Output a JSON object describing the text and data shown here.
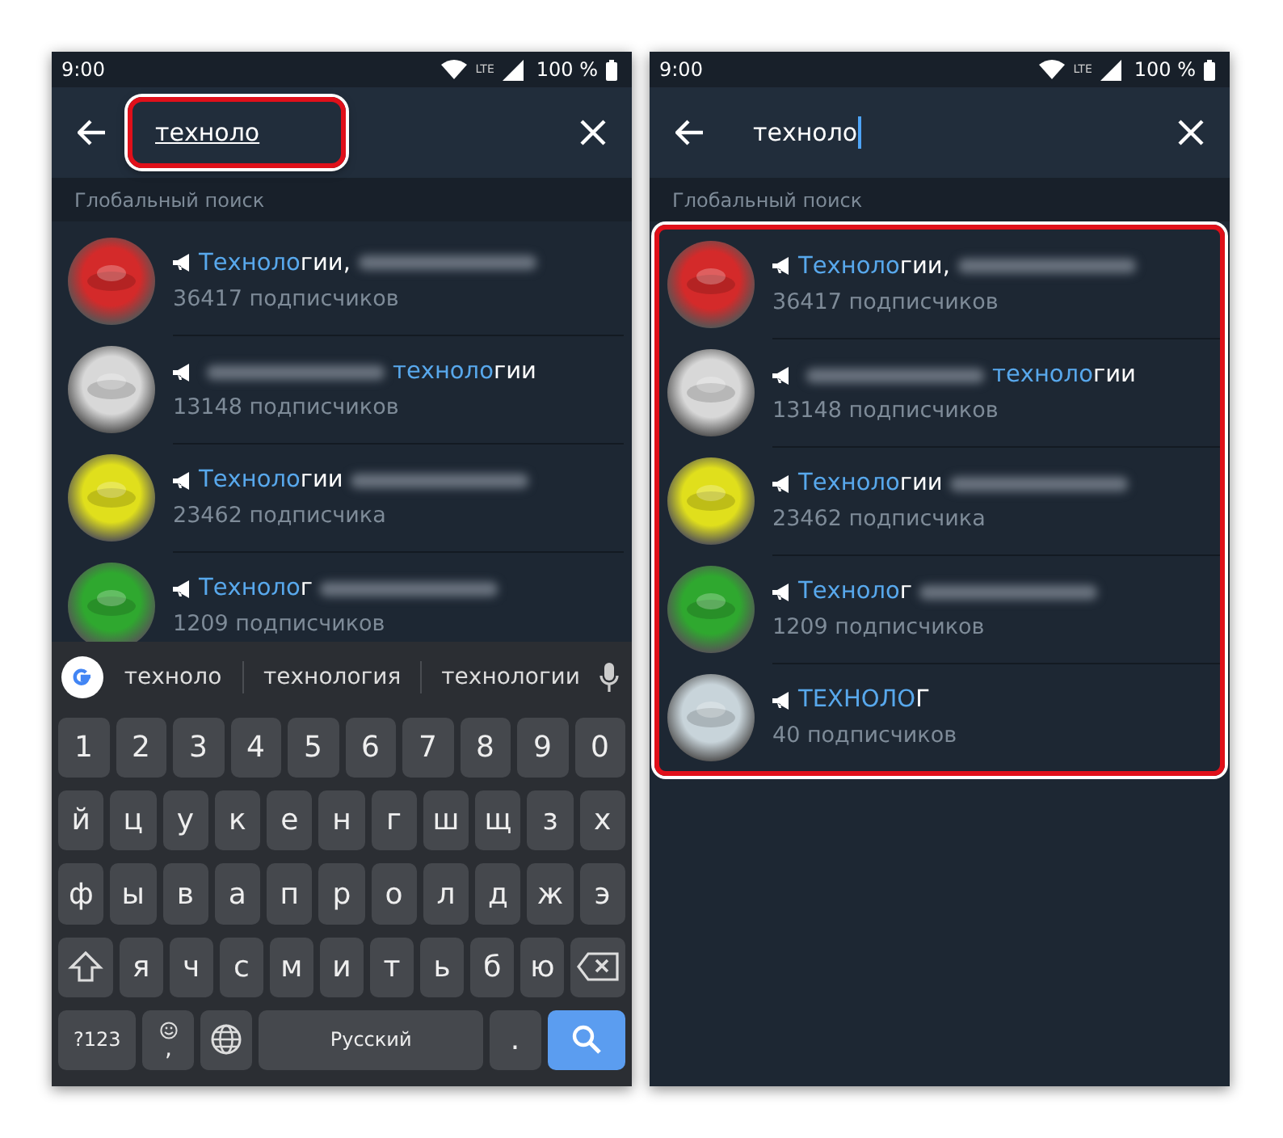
{
  "screens": [
    {
      "status_bar": {
        "time": "9:00",
        "network": "LTE",
        "battery": "100 %"
      },
      "search": {
        "value": "техноло",
        "underlined": true,
        "cursor": false,
        "highlighted": true
      },
      "section_header": "Глобальный поиск",
      "results_highlighted": false,
      "results": [
        {
          "color": "#d42a2a",
          "title": [
            {
              "kind": "match",
              "text": "Техноло"
            },
            {
              "kind": "text",
              "text": "гии,"
            },
            {
              "kind": "blur"
            }
          ],
          "subtitle": "36417 подписчиков"
        },
        {
          "color": "#d8d8d8",
          "title": [
            {
              "kind": "blur"
            },
            {
              "kind": "match",
              "text": "техноло"
            },
            {
              "kind": "text",
              "text": "гии"
            }
          ],
          "subtitle": "13148 подписчиков"
        },
        {
          "color": "#e0df1c",
          "title": [
            {
              "kind": "match",
              "text": "Техноло"
            },
            {
              "kind": "text",
              "text": "гии"
            },
            {
              "kind": "blur"
            }
          ],
          "subtitle": "23462 подписчика"
        },
        {
          "color": "#2fa82f",
          "title": [
            {
              "kind": "match",
              "text": "Техноло"
            },
            {
              "kind": "text",
              "text": "г"
            },
            {
              "kind": "blur"
            }
          ],
          "subtitle": "1209 подписчиков"
        }
      ],
      "keyboard": {
        "suggestions": [
          "техноло",
          "технология",
          "технологии"
        ],
        "rows": [
          {
            "keys": [
              {
                "kind": "key",
                "text": "1"
              },
              {
                "kind": "key",
                "text": "2"
              },
              {
                "kind": "key",
                "text": "3"
              },
              {
                "kind": "key",
                "text": "4"
              },
              {
                "kind": "key",
                "text": "5"
              },
              {
                "kind": "key",
                "text": "6"
              },
              {
                "kind": "key",
                "text": "7"
              },
              {
                "kind": "key",
                "text": "8"
              },
              {
                "kind": "key",
                "text": "9"
              },
              {
                "kind": "key",
                "text": "0"
              }
            ]
          },
          {
            "keys": [
              {
                "kind": "key",
                "text": "й"
              },
              {
                "kind": "key",
                "text": "ц"
              },
              {
                "kind": "key",
                "text": "у"
              },
              {
                "kind": "key",
                "text": "к"
              },
              {
                "kind": "key",
                "text": "е"
              },
              {
                "kind": "key",
                "text": "н"
              },
              {
                "kind": "key",
                "text": "г"
              },
              {
                "kind": "key",
                "text": "ш"
              },
              {
                "kind": "key",
                "text": "щ"
              },
              {
                "kind": "key",
                "text": "з"
              },
              {
                "kind": "key",
                "text": "х"
              }
            ]
          },
          {
            "keys": [
              {
                "kind": "key",
                "text": "ф"
              },
              {
                "kind": "key",
                "text": "ы"
              },
              {
                "kind": "key",
                "text": "в"
              },
              {
                "kind": "key",
                "text": "а"
              },
              {
                "kind": "key",
                "text": "п"
              },
              {
                "kind": "key",
                "text": "р"
              },
              {
                "kind": "key",
                "text": "о"
              },
              {
                "kind": "key",
                "text": "л"
              },
              {
                "kind": "key",
                "text": "д"
              },
              {
                "kind": "key",
                "text": "ж"
              },
              {
                "kind": "key",
                "text": "э"
              }
            ]
          },
          {
            "keys": [
              {
                "kind": "shift"
              },
              {
                "kind": "key",
                "text": "я"
              },
              {
                "kind": "key",
                "text": "ч"
              },
              {
                "kind": "key",
                "text": "с"
              },
              {
                "kind": "key",
                "text": "м"
              },
              {
                "kind": "key",
                "text": "и"
              },
              {
                "kind": "key",
                "text": "т"
              },
              {
                "kind": "key",
                "text": "ь"
              },
              {
                "kind": "key",
                "text": "б"
              },
              {
                "kind": "key",
                "text": "ю"
              },
              {
                "kind": "backspace"
              }
            ]
          },
          {
            "keys": [
              {
                "kind": "mode",
                "text": "?123"
              },
              {
                "kind": "emoji",
                "text": ","
              },
              {
                "kind": "globe"
              },
              {
                "kind": "space",
                "text": "Русский"
              },
              {
                "kind": "key",
                "text": "."
              },
              {
                "kind": "search"
              }
            ]
          }
        ]
      }
    },
    {
      "status_bar": {
        "time": "9:00",
        "network": "LTE",
        "battery": "100 %"
      },
      "search": {
        "value": "техноло",
        "underlined": false,
        "cursor": true,
        "highlighted": false
      },
      "section_header": "Глобальный поиск",
      "results_highlighted": true,
      "results": [
        {
          "color": "#d42a2a",
          "title": [
            {
              "kind": "match",
              "text": "Техноло"
            },
            {
              "kind": "text",
              "text": "гии,"
            },
            {
              "kind": "blur"
            }
          ],
          "subtitle": "36417 подписчиков"
        },
        {
          "color": "#d8d8d8",
          "title": [
            {
              "kind": "blur"
            },
            {
              "kind": "match",
              "text": "техноло"
            },
            {
              "kind": "text",
              "text": "гии"
            }
          ],
          "subtitle": "13148 подписчиков"
        },
        {
          "color": "#e0df1c",
          "title": [
            {
              "kind": "match",
              "text": "Техноло"
            },
            {
              "kind": "text",
              "text": "гии"
            },
            {
              "kind": "blur"
            }
          ],
          "subtitle": "23462 подписчика"
        },
        {
          "color": "#2fa82f",
          "title": [
            {
              "kind": "match",
              "text": "Техноло"
            },
            {
              "kind": "text",
              "text": "г"
            },
            {
              "kind": "blur"
            }
          ],
          "subtitle": "1209 подписчиков"
        },
        {
          "color": "#c8d4da",
          "title": [
            {
              "kind": "match",
              "text": "ТЕХНОЛО"
            },
            {
              "kind": "text",
              "text": "Г"
            }
          ],
          "subtitle": "40 подписчиков"
        }
      ]
    }
  ]
}
